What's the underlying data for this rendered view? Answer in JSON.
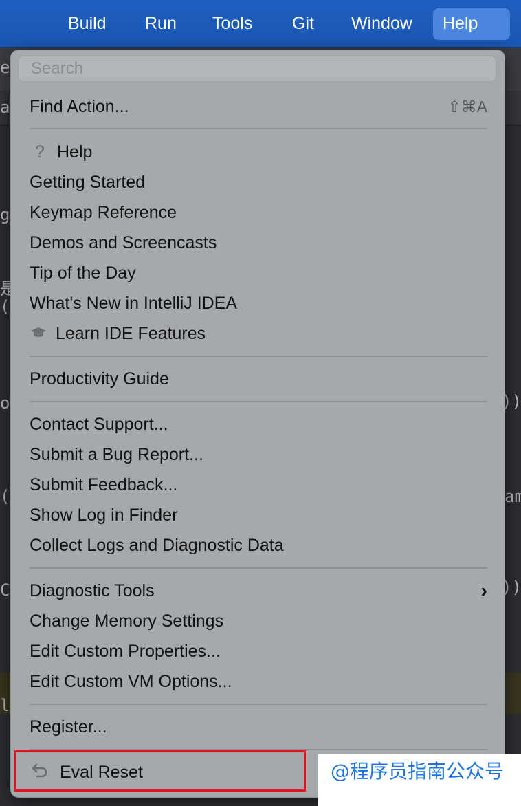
{
  "menubar": {
    "items": [
      "Build",
      "Run",
      "Tools",
      "Git",
      "Window",
      "Help"
    ],
    "active": "Help"
  },
  "ide_fragments": [
    "ea",
    "a",
    "ge",
    "是",
    "()",
    "or",
    "))",
    "(D",
    "am",
    "Co",
    "))",
    "lu"
  ],
  "menu": {
    "search_placeholder": "Search",
    "find_action": {
      "label": "Find Action...",
      "shortcut": "⇧⌘A"
    },
    "help_icon": "question-icon",
    "items": {
      "help": "Help",
      "getting_started": "Getting Started",
      "keymap": "Keymap Reference",
      "demos": "Demos and Screencasts",
      "tip": "Tip of the Day",
      "whats_new": "What's New in IntelliJ IDEA",
      "learn": "Learn IDE Features",
      "productivity": "Productivity Guide",
      "contact": "Contact Support...",
      "bug": "Submit a Bug Report...",
      "feedback": "Submit Feedback...",
      "show_log": "Show Log in Finder",
      "collect_logs": "Collect Logs and Diagnostic Data",
      "diagnostic_tools": "Diagnostic Tools",
      "memory": "Change Memory Settings",
      "custom_props": "Edit Custom Properties...",
      "vm_options": "Edit Custom VM Options...",
      "register": "Register...",
      "eval_reset": "Eval Reset"
    }
  },
  "watermark": "@程序员指南公众号",
  "colors": {
    "menubar": "#1a56b3",
    "menu_bg": "#a6a9ac",
    "highlight": "#e01818",
    "watermark": "#1a73e8"
  }
}
